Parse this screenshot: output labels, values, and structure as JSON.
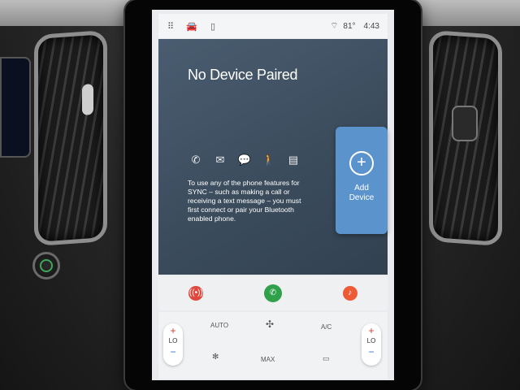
{
  "status_bar": {
    "icons": [
      "apps-icon",
      "car-icon",
      "phone-device-icon"
    ],
    "temperature": "81°",
    "time": "4:43"
  },
  "phone_panel": {
    "title": "No Device Paired",
    "feature_icons": [
      "phone-icon",
      "mail-icon",
      "messages-icon",
      "walking-icon",
      "contacts-icon"
    ],
    "message": "To use any of the phone features for SYNC – such as making a call or receiving a text message – you must first connect or pair your Bluetooth enabled phone.",
    "add_device_label_line1": "Add",
    "add_device_label_line2": "Device"
  },
  "shortcuts": [
    "radio-icon",
    "phone-icon",
    "music-icon"
  ],
  "climate": {
    "auto_label": "AUTO",
    "ac_label": "A/C",
    "max_label": "MAX",
    "left_temp": "LO",
    "right_temp": "LO",
    "plus": "+",
    "minus": "−"
  },
  "colors": {
    "panel_bg": "#3f5163",
    "add_device": "#5b93cc",
    "radio": "#e1473c",
    "phone": "#2fa14a",
    "music": "#ec5a36"
  }
}
